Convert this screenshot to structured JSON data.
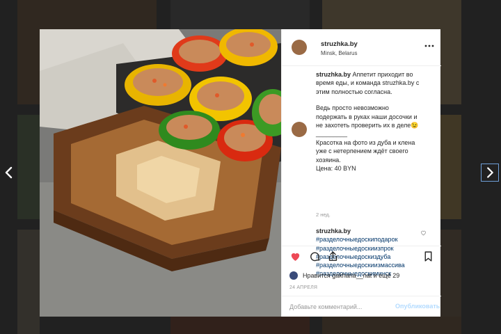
{
  "post": {
    "username": "struzhka.by",
    "location": "Minsk, Belarus",
    "caption": {
      "author": "struzhka.by",
      "lines_a": [
        "Аппетит приходит во",
        "время еды, и команда struzhka.by с",
        "этим полностью согласна."
      ],
      "lines_b": [
        "Ведь просто невозможно",
        "подержать в руках наши досочки и",
        "не захотеть проверить их в деле😉"
      ],
      "separator": "_________",
      "lines_c": [
        "Красотка на фото из дуба и клена",
        "уже с нетерпением ждёт своего",
        "хозяина."
      ],
      "price": "Цена: 40 BYN"
    },
    "time_ago": "2 нед.",
    "comment2": {
      "author": "struzhka.by",
      "hashtags": [
        "#разделочныедоскиподарок",
        "#разделочныедоскиизпрок",
        "#разделочныедоскиздуба",
        "#разделочныедоскиизмассива",
        "#разделочныедоскиминск"
      ]
    },
    "likes_text": "Нравится gakharia__nat и ещё 29",
    "date": "24 АПРЕЛЯ",
    "comment_placeholder": "Добавьте комментарий...",
    "publish_label": "Опубликовать"
  },
  "icons": {
    "more": "more-icon",
    "like": "heart-icon",
    "comment": "comment-icon",
    "share": "share-icon",
    "save": "bookmark-icon",
    "prev": "chevron-left-icon",
    "next": "chevron-right-icon"
  },
  "colors": {
    "like_red": "#ed4956",
    "hashtag_blue": "#003569",
    "publish_disabled": "#b3dbff"
  }
}
